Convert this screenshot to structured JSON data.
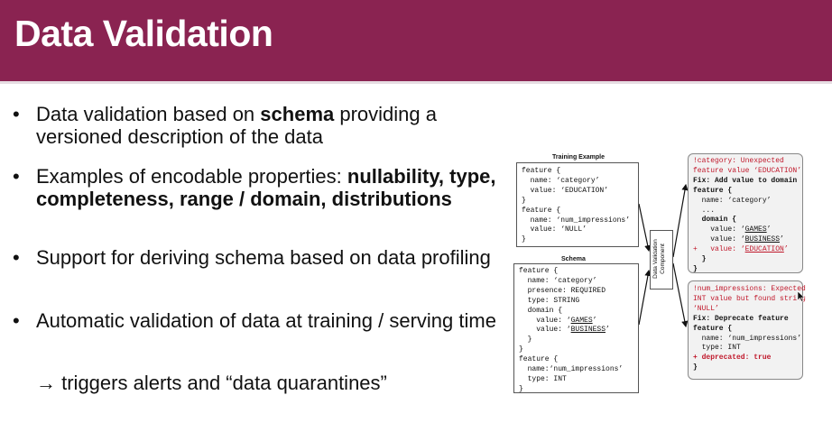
{
  "slide": {
    "title": "Data Validation",
    "bullets": [
      {
        "parts": [
          {
            "t": "Data validation based on ",
            "b": false
          },
          {
            "t": "schema",
            "b": true
          },
          {
            "t": " providing a versioned description of the data",
            "b": false
          }
        ]
      },
      {
        "parts": [
          {
            "t": "Examples of encodable properties: ",
            "b": false
          },
          {
            "t": "nullability, type, completeness, range / domain, distributions",
            "b": true
          }
        ]
      },
      {
        "parts": [
          {
            "t": "Support for deriving schema based on data profiling",
            "b": false
          }
        ]
      },
      {
        "parts": [
          {
            "t": "Automatic validation of data at training / serving time",
            "b": false
          }
        ]
      }
    ],
    "bullet_glyph": "•",
    "sub_point": "→ triggers alerts and “data quarantines”"
  },
  "diagram": {
    "training_example": {
      "caption": "Training Example",
      "lines": [
        "feature {",
        "  name: ‘category’",
        "  value: ‘EDUCATION’",
        "}",
        "feature {",
        "  name: ‘num_impressions’",
        "  value: ‘NULL’",
        "}"
      ]
    },
    "schema": {
      "caption": "Schema",
      "lines": [
        [
          {
            "t": "feature {"
          }
        ],
        [
          {
            "t": "  name: ‘category’"
          }
        ],
        [
          {
            "t": "  presence: REQUIRED"
          }
        ],
        [
          {
            "t": "  type: STRING"
          }
        ],
        [
          {
            "t": "  domain {"
          }
        ],
        [
          {
            "t": "    value: ‘"
          },
          {
            "t": "GAMES",
            "u": true
          },
          {
            "t": "’"
          }
        ],
        [
          {
            "t": "    value: ‘"
          },
          {
            "t": "BUSINESS",
            "u": true
          },
          {
            "t": "’"
          }
        ],
        [
          {
            "t": "  }"
          }
        ],
        [
          {
            "t": "}"
          }
        ],
        [
          {
            "t": "feature {"
          }
        ],
        [
          {
            "t": "  name:‘num_impressions’"
          }
        ],
        [
          {
            "t": "  type: INT"
          }
        ],
        [
          {
            "t": "}"
          }
        ]
      ]
    },
    "component_label": "Data Validation Component",
    "alert_category": {
      "lines": [
        [
          {
            "t": "!category: Unexpected",
            "red": true
          }
        ],
        [
          {
            "t": "feature value ‘EDUCATION’",
            "red": true
          }
        ],
        [
          {
            "t": "Fix: Add value to domain",
            "b": true
          }
        ],
        [
          {
            "t": "feature {",
            "b": true
          }
        ],
        [
          {
            "t": "  name: ‘category’"
          }
        ],
        [
          {
            "t": "  ..."
          }
        ],
        [
          {
            "t": "  domain {",
            "b": true
          }
        ],
        [
          {
            "t": "    value: ‘"
          },
          {
            "t": "GAMES",
            "u": true
          },
          {
            "t": "’"
          }
        ],
        [
          {
            "t": "    value: ‘"
          },
          {
            "t": "BUSINESS",
            "u": true
          },
          {
            "t": "’"
          }
        ],
        [
          {
            "t": "+   value: ‘",
            "red": true
          },
          {
            "t": "EDUCATION",
            "red": true,
            "u": true
          },
          {
            "t": "’",
            "red": true
          }
        ],
        [
          {
            "t": "  }",
            "b": true
          }
        ],
        [
          {
            "t": "}",
            "b": true
          }
        ]
      ]
    },
    "alert_impressions": {
      "lines": [
        [
          {
            "t": "!num_impressions: Expected",
            "red": true
          }
        ],
        [
          {
            "t": "INT value but found string",
            "red": true
          }
        ],
        [
          {
            "t": "‘NULL’",
            "red": true
          }
        ],
        [
          {
            "t": "Fix: Deprecate feature",
            "b": true
          }
        ],
        [
          {
            "t": "feature {",
            "b": true
          }
        ],
        [
          {
            "t": "  name: ‘num_impressions’"
          }
        ],
        [
          {
            "t": "  type: INT"
          }
        ],
        [
          {
            "t": "+ deprecated: true",
            "red": true,
            "b": true
          }
        ],
        [
          {
            "t": "}",
            "b": true
          }
        ]
      ]
    }
  },
  "colors": {
    "header": "#8a2351",
    "alert_red": "#c0182b"
  },
  "icons": [
    "mouse-cursor-icon",
    "arrow-right-icon"
  ]
}
